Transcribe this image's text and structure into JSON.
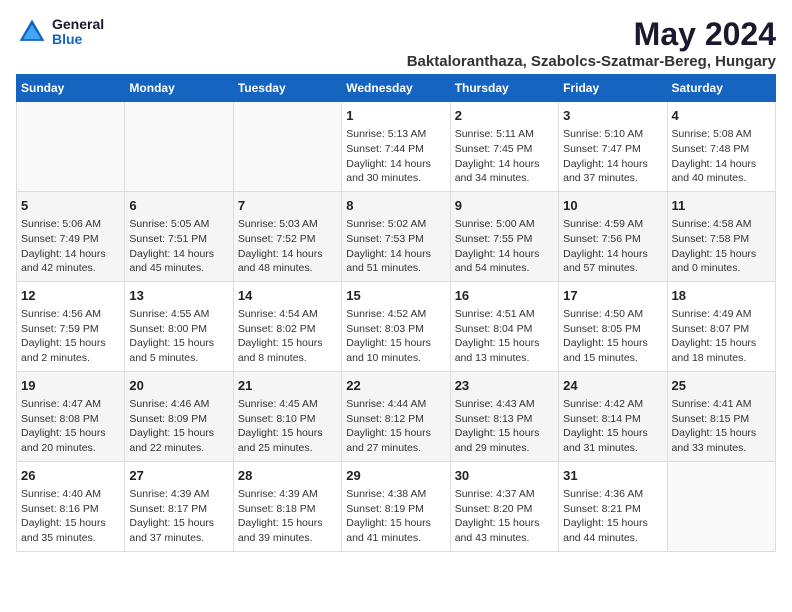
{
  "logo": {
    "general": "General",
    "blue": "Blue"
  },
  "title": "May 2024",
  "subtitle": "Baktaloranthaza, Szabolcs-Szatmar-Bereg, Hungary",
  "days_of_week": [
    "Sunday",
    "Monday",
    "Tuesday",
    "Wednesday",
    "Thursday",
    "Friday",
    "Saturday"
  ],
  "weeks": [
    [
      {
        "day": "",
        "info": ""
      },
      {
        "day": "",
        "info": ""
      },
      {
        "day": "",
        "info": ""
      },
      {
        "day": "1",
        "info": "Sunrise: 5:13 AM\nSunset: 7:44 PM\nDaylight: 14 hours\nand 30 minutes."
      },
      {
        "day": "2",
        "info": "Sunrise: 5:11 AM\nSunset: 7:45 PM\nDaylight: 14 hours\nand 34 minutes."
      },
      {
        "day": "3",
        "info": "Sunrise: 5:10 AM\nSunset: 7:47 PM\nDaylight: 14 hours\nand 37 minutes."
      },
      {
        "day": "4",
        "info": "Sunrise: 5:08 AM\nSunset: 7:48 PM\nDaylight: 14 hours\nand 40 minutes."
      }
    ],
    [
      {
        "day": "5",
        "info": "Sunrise: 5:06 AM\nSunset: 7:49 PM\nDaylight: 14 hours\nand 42 minutes."
      },
      {
        "day": "6",
        "info": "Sunrise: 5:05 AM\nSunset: 7:51 PM\nDaylight: 14 hours\nand 45 minutes."
      },
      {
        "day": "7",
        "info": "Sunrise: 5:03 AM\nSunset: 7:52 PM\nDaylight: 14 hours\nand 48 minutes."
      },
      {
        "day": "8",
        "info": "Sunrise: 5:02 AM\nSunset: 7:53 PM\nDaylight: 14 hours\nand 51 minutes."
      },
      {
        "day": "9",
        "info": "Sunrise: 5:00 AM\nSunset: 7:55 PM\nDaylight: 14 hours\nand 54 minutes."
      },
      {
        "day": "10",
        "info": "Sunrise: 4:59 AM\nSunset: 7:56 PM\nDaylight: 14 hours\nand 57 minutes."
      },
      {
        "day": "11",
        "info": "Sunrise: 4:58 AM\nSunset: 7:58 PM\nDaylight: 15 hours\nand 0 minutes."
      }
    ],
    [
      {
        "day": "12",
        "info": "Sunrise: 4:56 AM\nSunset: 7:59 PM\nDaylight: 15 hours\nand 2 minutes."
      },
      {
        "day": "13",
        "info": "Sunrise: 4:55 AM\nSunset: 8:00 PM\nDaylight: 15 hours\nand 5 minutes."
      },
      {
        "day": "14",
        "info": "Sunrise: 4:54 AM\nSunset: 8:02 PM\nDaylight: 15 hours\nand 8 minutes."
      },
      {
        "day": "15",
        "info": "Sunrise: 4:52 AM\nSunset: 8:03 PM\nDaylight: 15 hours\nand 10 minutes."
      },
      {
        "day": "16",
        "info": "Sunrise: 4:51 AM\nSunset: 8:04 PM\nDaylight: 15 hours\nand 13 minutes."
      },
      {
        "day": "17",
        "info": "Sunrise: 4:50 AM\nSunset: 8:05 PM\nDaylight: 15 hours\nand 15 minutes."
      },
      {
        "day": "18",
        "info": "Sunrise: 4:49 AM\nSunset: 8:07 PM\nDaylight: 15 hours\nand 18 minutes."
      }
    ],
    [
      {
        "day": "19",
        "info": "Sunrise: 4:47 AM\nSunset: 8:08 PM\nDaylight: 15 hours\nand 20 minutes."
      },
      {
        "day": "20",
        "info": "Sunrise: 4:46 AM\nSunset: 8:09 PM\nDaylight: 15 hours\nand 22 minutes."
      },
      {
        "day": "21",
        "info": "Sunrise: 4:45 AM\nSunset: 8:10 PM\nDaylight: 15 hours\nand 25 minutes."
      },
      {
        "day": "22",
        "info": "Sunrise: 4:44 AM\nSunset: 8:12 PM\nDaylight: 15 hours\nand 27 minutes."
      },
      {
        "day": "23",
        "info": "Sunrise: 4:43 AM\nSunset: 8:13 PM\nDaylight: 15 hours\nand 29 minutes."
      },
      {
        "day": "24",
        "info": "Sunrise: 4:42 AM\nSunset: 8:14 PM\nDaylight: 15 hours\nand 31 minutes."
      },
      {
        "day": "25",
        "info": "Sunrise: 4:41 AM\nSunset: 8:15 PM\nDaylight: 15 hours\nand 33 minutes."
      }
    ],
    [
      {
        "day": "26",
        "info": "Sunrise: 4:40 AM\nSunset: 8:16 PM\nDaylight: 15 hours\nand 35 minutes."
      },
      {
        "day": "27",
        "info": "Sunrise: 4:39 AM\nSunset: 8:17 PM\nDaylight: 15 hours\nand 37 minutes."
      },
      {
        "day": "28",
        "info": "Sunrise: 4:39 AM\nSunset: 8:18 PM\nDaylight: 15 hours\nand 39 minutes."
      },
      {
        "day": "29",
        "info": "Sunrise: 4:38 AM\nSunset: 8:19 PM\nDaylight: 15 hours\nand 41 minutes."
      },
      {
        "day": "30",
        "info": "Sunrise: 4:37 AM\nSunset: 8:20 PM\nDaylight: 15 hours\nand 43 minutes."
      },
      {
        "day": "31",
        "info": "Sunrise: 4:36 AM\nSunset: 8:21 PM\nDaylight: 15 hours\nand 44 minutes."
      },
      {
        "day": "",
        "info": ""
      }
    ]
  ]
}
